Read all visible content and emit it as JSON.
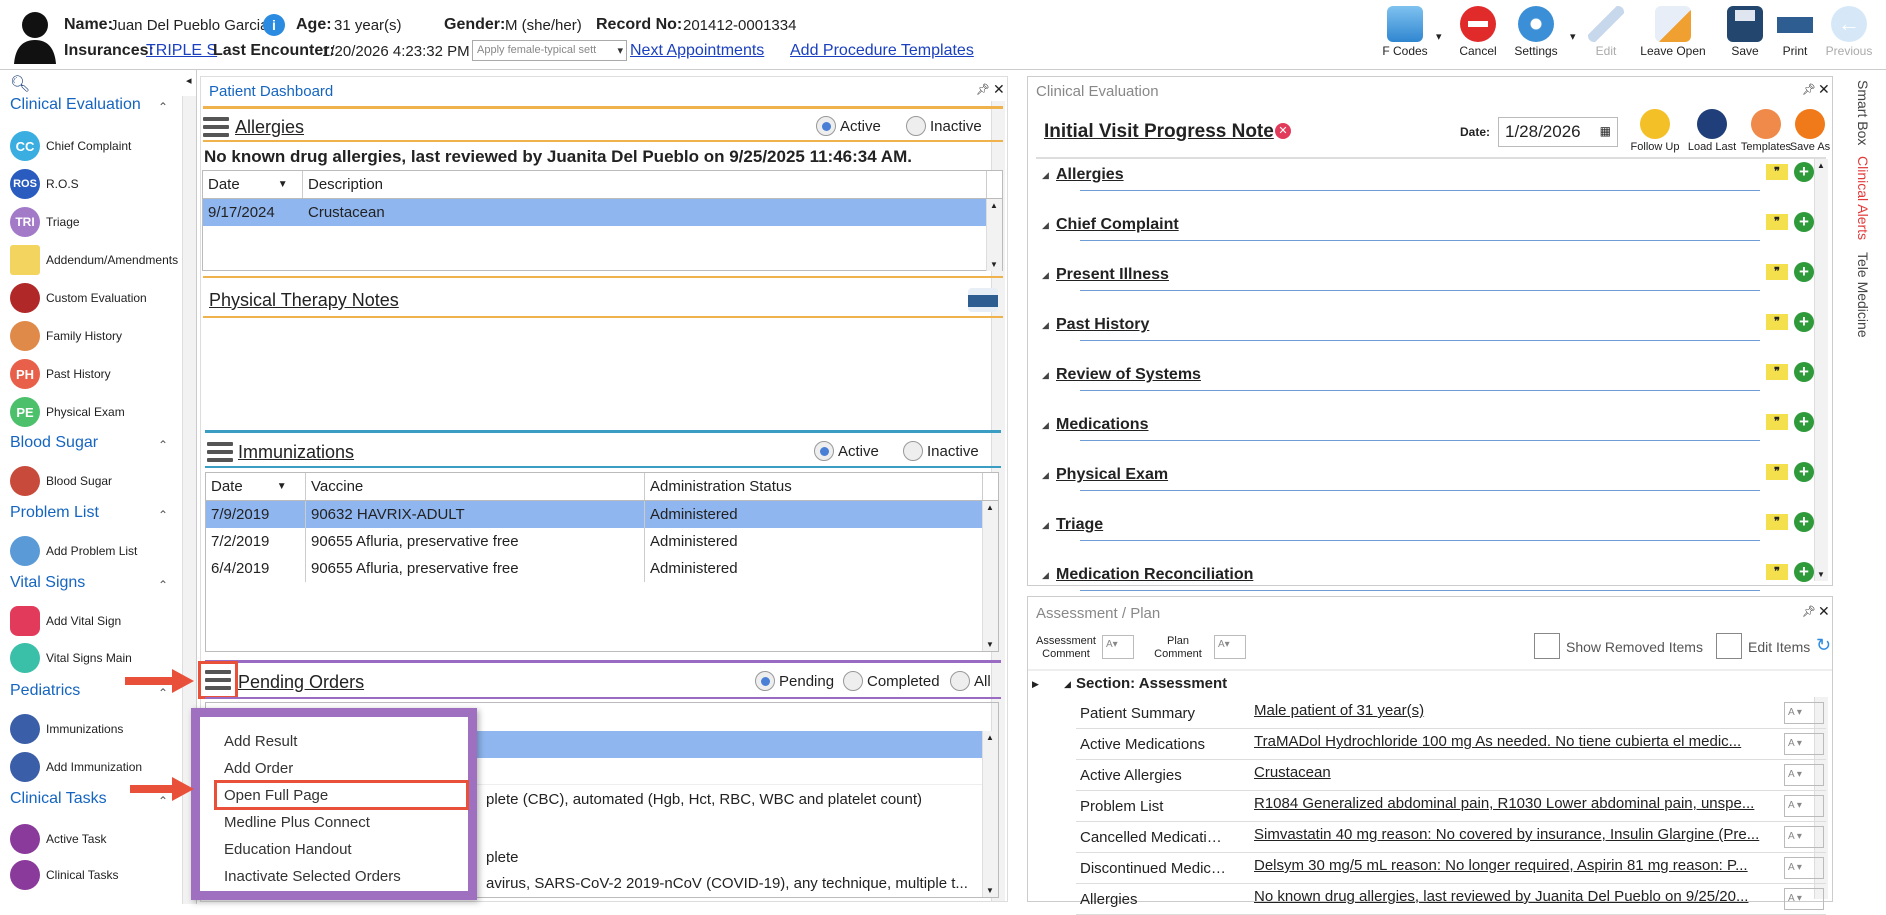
{
  "header": {
    "name_label": "Name:",
    "name": "Juan Del Pueblo Garcia",
    "age_label": "Age:",
    "age": "31 year(s)",
    "gender_label": "Gender:",
    "gender": "M (she/her)",
    "record_label": "Record No:",
    "record": "201412-0001334",
    "ins_label": "Insurances:",
    "insurance": "TRIPLE S",
    "last_enc_label": "Last Encounter:",
    "last_enc": "1/20/2026 4:23:32 PM",
    "template_select": "Apply female-typical sett",
    "next_appt": "Next Appointments",
    "add_proc": "Add Procedure Templates"
  },
  "toolbar": {
    "fcodes": "F Codes",
    "cancel": "Cancel",
    "settings": "Settings",
    "edit": "Edit",
    "leave_open": "Leave Open",
    "save": "Save",
    "print": "Print",
    "previous": "Previous"
  },
  "nav": {
    "sections": {
      "clinical_eval": "Clinical Evaluation",
      "blood_sugar": "Blood Sugar",
      "problem_list": "Problem List",
      "vital_signs": "Vital Signs",
      "pediatrics": "Pediatrics",
      "clinical_tasks": "Clinical Tasks"
    },
    "items": {
      "cc": "Chief Complaint",
      "ros": "R.O.S",
      "triage": "Triage",
      "addendum": "Addendum/Amendments",
      "custom": "Custom Evaluation",
      "family": "Family History",
      "past": "Past History",
      "pe": "Physical Exam",
      "bs": "Blood Sugar",
      "add_problem": "Add Problem List",
      "add_vital": "Add Vital Sign",
      "vital_main": "Vital Signs Main",
      "immun": "Immunizations",
      "add_immun": "Add Immunization",
      "active_task": "Active Task",
      "clinical_tasks": "Clinical Tasks"
    },
    "icons": {
      "cc": "CC",
      "ros": "ROS",
      "tri": "TRI",
      "ph": "PH",
      "pe": "PE"
    }
  },
  "dashboard": {
    "title": "Patient Dashboard",
    "allergies": {
      "title": "Allergies",
      "active": "Active",
      "inactive": "Inactive",
      "note": "No known drug allergies, last reviewed by Juanita Del Pueblo on 9/25/2025 11:46:34 AM.",
      "cols": [
        "Date",
        "Description"
      ],
      "rows": [
        [
          "9/17/2024",
          "Crustacean"
        ]
      ]
    },
    "pt_notes": {
      "title": "Physical Therapy Notes"
    },
    "immunizations": {
      "title": "Immunizations",
      "active": "Active",
      "inactive": "Inactive",
      "cols": [
        "Date",
        "Vaccine",
        "Administration Status"
      ],
      "rows": [
        [
          "7/9/2019",
          "90632 HAVRIX-ADULT",
          "Administered"
        ],
        [
          "7/2/2019",
          "90655 Afluria, preservative free",
          "Administered"
        ],
        [
          "6/4/2019",
          "90655 Afluria, preservative free",
          "Administered"
        ]
      ]
    },
    "pending": {
      "title": "Pending Orders",
      "pending": "Pending",
      "completed": "Completed",
      "all": "All",
      "partial_rows": [
        "plete (CBC), automated (Hgb, Hct, RBC, WBC and platelet count)",
        "plete",
        "avirus, SARS-CoV-2 2019-nCoV (COVID-19), any technique, multiple t..."
      ]
    }
  },
  "menu": {
    "add_result": "Add Result",
    "add_order": "Add Order",
    "open_full": "Open Full Page",
    "medline": "Medline Plus Connect",
    "education": "Education Handout",
    "inactivate": "Inactivate Selected Orders"
  },
  "clinical": {
    "title": "Clinical Evaluation",
    "note_title": "Initial Visit Progress Note",
    "date_label": "Date:",
    "date": "1/28/2026",
    "actions": {
      "follow": "Follow Up",
      "load": "Load Last",
      "templates": "Templates",
      "save_as": "Save As"
    },
    "sections": [
      "Allergies",
      "Chief Complaint",
      "Present Illness",
      "Past History",
      "Review of Systems",
      "Medications",
      "Physical Exam",
      "Triage",
      "Medication Reconciliation"
    ],
    "quote_icon": "❞"
  },
  "assessment": {
    "title": "Assessment / Plan",
    "assess_comment": "Assessment Comment",
    "plan_comment": "Plan Comment",
    "show_removed": "Show Removed Items",
    "edit_items": "Edit Items",
    "section": "Section: Assessment",
    "rows": [
      [
        "Patient Summary",
        "Male patient of 31 year(s)"
      ],
      [
        "Active Medications",
        "TraMADol Hydrochloride 100 mg As needed.  No tiene cubierta el medic..."
      ],
      [
        "Active Allergies",
        "Crustacean"
      ],
      [
        "Problem List",
        "R1084 Generalized abdominal pain, R1030 Lower abdominal pain, unspe..."
      ],
      [
        "Cancelled Medications",
        "Simvastatin 40 mg reason: No covered by insurance, Insulin Glargine (Pre..."
      ],
      [
        "Discontinued Medicati...",
        "Delsym 30 mg/5 mL reason: No longer required, Aspirin 81 mg reason: P..."
      ],
      [
        "Allergies",
        "No known drug allergies, last reviewed by Juanita Del Pueblo on 9/25/20..."
      ]
    ]
  },
  "side_tabs": {
    "smart": "Smart Box",
    "alerts": "Clinical Alerts",
    "tele": "Tele Medicine"
  },
  "colors": {
    "accent": "#1565c0",
    "selected": "#8fb6ef",
    "highlight": "#e8503a",
    "menu_border": "#a070c0",
    "orange_line": "#f0b24a",
    "teal_line": "#3a9ec4",
    "purple_line": "#9a6bc2"
  }
}
